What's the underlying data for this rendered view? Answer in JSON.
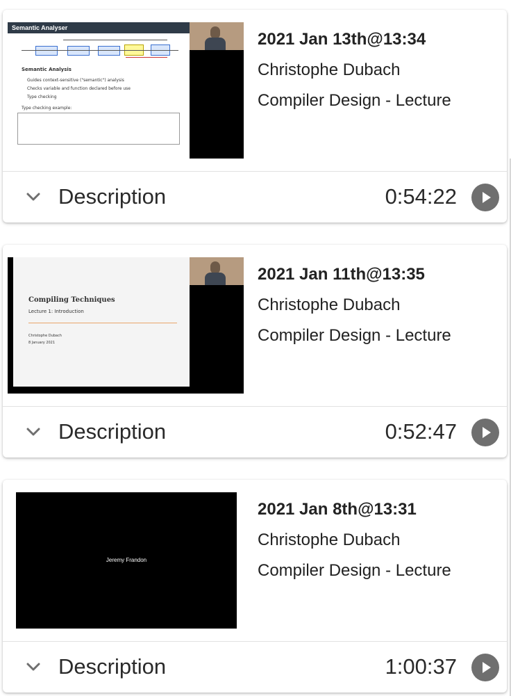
{
  "lectures": [
    {
      "date": "2021 Jan 13th@13:34",
      "author": "Christophe Dubach",
      "course": "Compiler Design - Lecture",
      "description_label": "Description",
      "duration": "0:54:22",
      "thumbnail": {
        "slide_title": "Semantic Analyser",
        "heading": "Semantic Analysis",
        "bullets": [
          "Guides context-sensitive (\"semantic\") analysis",
          "Checks variable and function declared before use",
          "Type checking"
        ],
        "example_label": "Type checking example:"
      }
    },
    {
      "date": "2021 Jan 11th@13:35",
      "author": "Christophe Dubach",
      "course": "Compiler Design - Lecture",
      "description_label": "Description",
      "duration": "0:52:47",
      "thumbnail": {
        "slide_title": "Compiling Techniques",
        "subtitle": "Lecture 1: Introduction",
        "presenter": "Christophe Dubach",
        "slide_date": "8 January 2021"
      }
    },
    {
      "date": "2021 Jan 8th@13:31",
      "author": "Christophe Dubach",
      "course": "Compiler Design - Lecture",
      "description_label": "Description",
      "duration": "1:00:37",
      "thumbnail": {
        "participant_name": "Jeremy Frandon"
      }
    }
  ],
  "colors": {
    "icon_gray": "#6f6f6f",
    "text": "#222222"
  },
  "icons": {
    "expand": "chevron-down-icon",
    "play": "play-circle-icon"
  }
}
